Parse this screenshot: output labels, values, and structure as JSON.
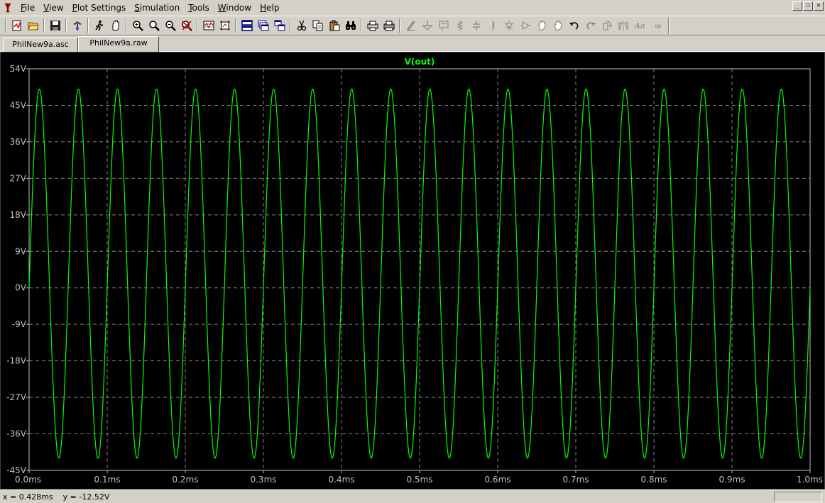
{
  "menu": {
    "items": [
      {
        "first": "F",
        "rest": "ile"
      },
      {
        "first": "V",
        "rest": "iew"
      },
      {
        "first": "P",
        "rest": "lot Settings"
      },
      {
        "first": "S",
        "rest": "imulation"
      },
      {
        "first": "T",
        "rest": "ools"
      },
      {
        "first": "W",
        "rest": "indow"
      },
      {
        "first": "H",
        "rest": "elp"
      }
    ]
  },
  "toolbar": {
    "icons": [
      "new-schematic-icon",
      "open-icon",
      "save-icon",
      "control-panel-icon",
      "run-icon",
      "halt-icon",
      "zoom-in-icon",
      "zoom-full-icon",
      "zoom-out-icon",
      "zoom-cancel-icon",
      "autorange-icon",
      "mark-unused-icon",
      "tile-horizontal-icon",
      "cascade-icon",
      "tile-vertical-icon",
      "cut-icon",
      "copy-icon",
      "paste-icon",
      "find-icon",
      "print-preview-icon",
      "print-icon",
      "draw-wire-icon",
      "ground-icon",
      "label-net-icon",
      "resistor-icon",
      "capacitor-icon",
      "inductor-icon",
      "diode-icon",
      "component-icon",
      "move-icon",
      "drag-icon",
      "undo-icon",
      "redo-icon",
      "rotate-icon",
      "mirror-icon",
      "text-icon",
      "spice-directive-icon"
    ]
  },
  "tabs": [
    {
      "label": "PhilNew9a.asc"
    },
    {
      "label": "PhilNew9a.raw"
    }
  ],
  "status": {
    "cursor_readout": "x = 0.428ms    y = -12.52V"
  },
  "colors": {
    "trace": "#00ff00",
    "grid": "#808080",
    "background": "#000000",
    "tick_text": "#c0c0c0"
  },
  "chart_data": {
    "type": "line",
    "title": "V(out)",
    "xlabel": "",
    "ylabel": "",
    "xlim": [
      0,
      1.0
    ],
    "ylim": [
      -45,
      54
    ],
    "x_unit": "ms",
    "y_unit": "V",
    "x_ticks": [
      "0.0ms",
      "0.1ms",
      "0.2ms",
      "0.3ms",
      "0.4ms",
      "0.5ms",
      "0.6ms",
      "0.7ms",
      "0.8ms",
      "0.9ms",
      "1.0ms"
    ],
    "y_ticks": [
      "54V",
      "45V",
      "36V",
      "27V",
      "18V",
      "9V",
      "0V",
      "-9V",
      "-18V",
      "-27V",
      "-36V",
      "-45V"
    ],
    "grid": true,
    "series": [
      {
        "name": "V(out)",
        "waveform": "sine",
        "frequency_khz": 20,
        "peak_v": 49,
        "trough_v": -42,
        "start_v": 0,
        "end_v": -17,
        "peaks_ms": [
          0.015,
          0.065,
          0.115,
          0.165,
          0.215,
          0.265,
          0.315,
          0.365,
          0.415,
          0.465,
          0.515,
          0.565,
          0.615,
          0.665,
          0.715,
          0.765,
          0.815,
          0.865,
          0.915,
          0.965
        ],
        "troughs_ms": [
          0.04,
          0.09,
          0.14,
          0.19,
          0.24,
          0.29,
          0.34,
          0.39,
          0.44,
          0.49,
          0.54,
          0.59,
          0.64,
          0.69,
          0.74,
          0.79,
          0.84,
          0.89,
          0.94,
          0.99
        ]
      }
    ]
  }
}
